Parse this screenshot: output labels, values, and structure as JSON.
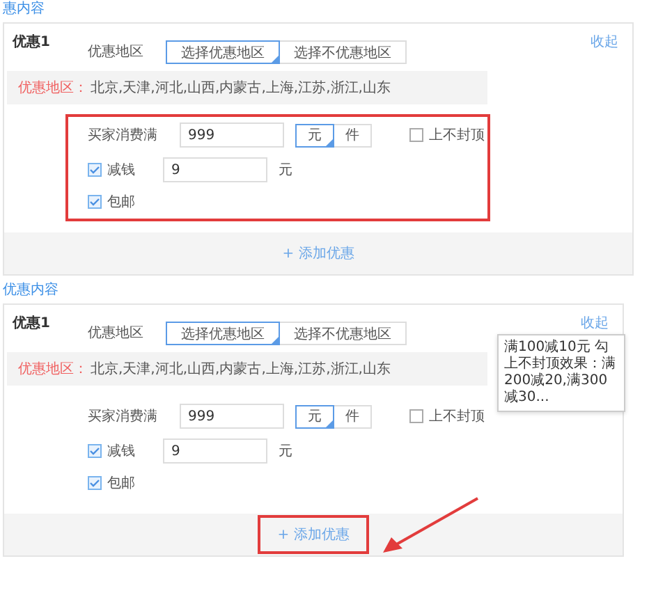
{
  "sections": [
    {
      "heading": "惠内容",
      "card": {
        "title": "优惠1",
        "collapse_link": "收起",
        "region_label": "优惠地区",
        "region_options": [
          {
            "label": "选择优惠地区",
            "selected": true
          },
          {
            "label": "选择不优惠地区",
            "selected": false
          }
        ],
        "note_label": "优惠地区：",
        "note_value": "北京,天津,河北,山西,内蒙古,上海,江苏,浙江,山东",
        "threshold_label": "买家消费满",
        "threshold_value": "999",
        "unit_options": [
          {
            "label": "元",
            "selected": true
          },
          {
            "label": "件",
            "selected": false
          }
        ],
        "no_cap": {
          "label": "上不封顶",
          "checked": false
        },
        "discount": {
          "label": "减钱",
          "checked": true,
          "value": "9",
          "unit": "元"
        },
        "free_shipping": {
          "label": "包邮",
          "checked": true
        },
        "form_highlighted": true,
        "add_button": "+ 添加优惠",
        "add_button_highlighted": false
      }
    },
    {
      "heading": "优惠内容",
      "card": {
        "title": "优惠1",
        "collapse_link": "收起",
        "region_label": "优惠地区",
        "region_options": [
          {
            "label": "选择优惠地区",
            "selected": true
          },
          {
            "label": "选择不优惠地区",
            "selected": false
          }
        ],
        "note_label": "优惠地区：",
        "note_value": "北京,天津,河北,山西,内蒙古,上海,江苏,浙江,山东",
        "threshold_label": "买家消费满",
        "threshold_value": "999",
        "unit_options": [
          {
            "label": "元",
            "selected": true
          },
          {
            "label": "件",
            "selected": false
          }
        ],
        "no_cap": {
          "label": "上不封顶",
          "checked": false
        },
        "tooltip": "满100减10元 勾上不封顶效果：满200减20,满300减30...",
        "discount": {
          "label": "减钱",
          "checked": true,
          "value": "9",
          "unit": "元"
        },
        "free_shipping": {
          "label": "包邮",
          "checked": true
        },
        "form_highlighted": false,
        "add_button": "+ 添加优惠",
        "add_button_highlighted": true
      }
    }
  ]
}
